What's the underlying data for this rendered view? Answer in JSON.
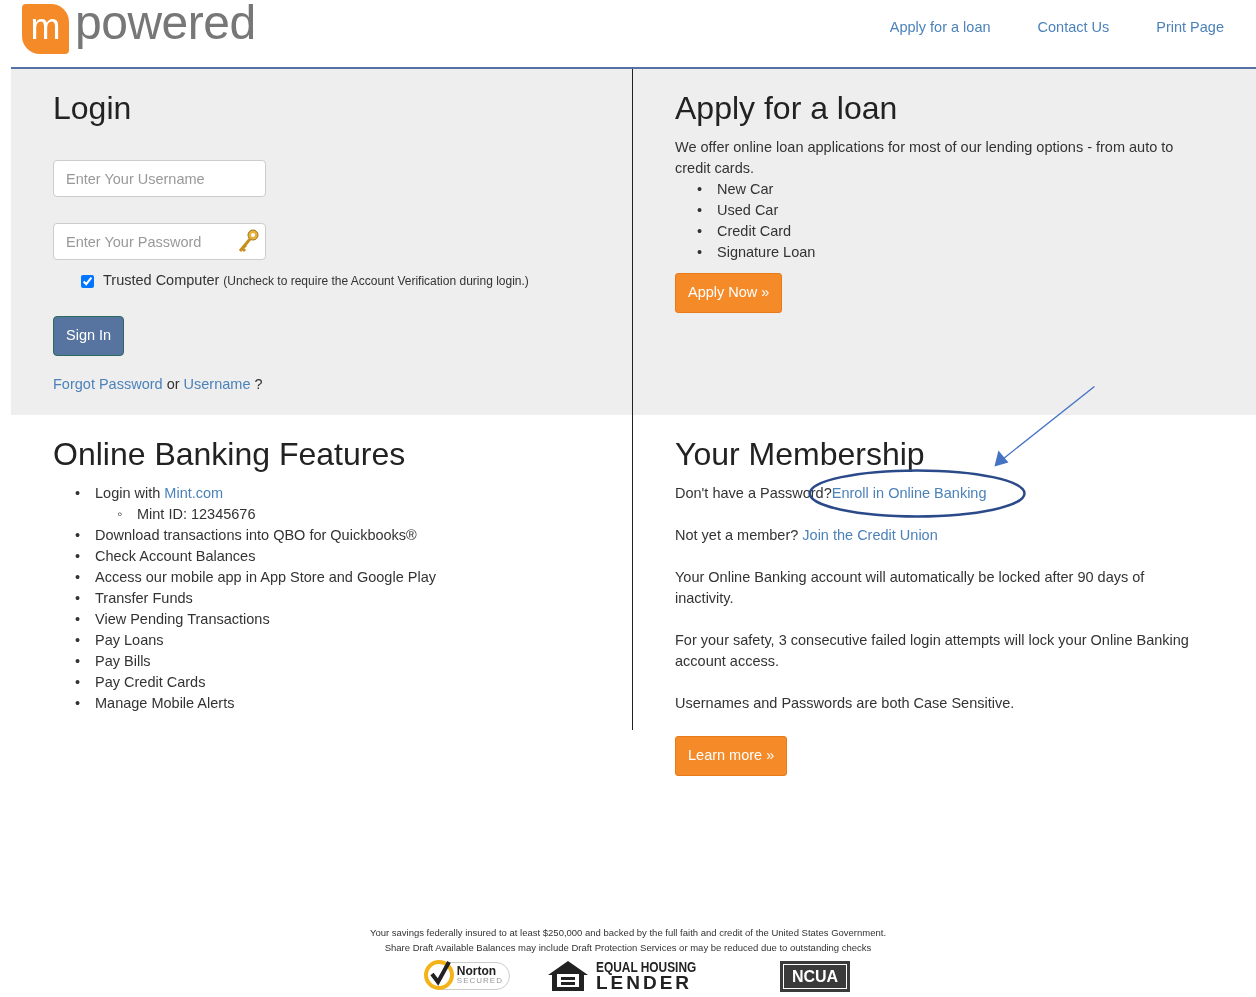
{
  "logo": {
    "mark": "m",
    "text": "powered"
  },
  "nav": [
    {
      "label": "Apply for a loan"
    },
    {
      "label": "Contact Us"
    },
    {
      "label": "Print Page"
    }
  ],
  "login": {
    "title": "Login",
    "username": {
      "placeholder": "Enter Your Username"
    },
    "password": {
      "placeholder": "Enter Your Password"
    },
    "trusted": {
      "checked": true,
      "label": "Trusted Computer",
      "note": "(Uncheck to require the Account Verification during login.)"
    },
    "sign_in": "Sign In",
    "forgot": {
      "link1": "Forgot Password",
      "middle": "or",
      "link2": "Username",
      "end": "?"
    }
  },
  "loan": {
    "title": "Apply for a loan",
    "intro": "We offer online loan applications for most of our lending options - from auto to credit cards.",
    "items": [
      {
        "marker": "•",
        "text": "New Car"
      },
      {
        "marker": "•",
        "text": "Used Car"
      },
      {
        "marker": "•",
        "text": "Credit Card"
      },
      {
        "marker": "•",
        "text": "Signature Loan"
      }
    ],
    "button": "Apply Now »"
  },
  "features": {
    "title": "Online Banking Features",
    "items": [
      {
        "marker": "•",
        "text": "Login with ",
        "link": "Mint.com",
        "children": [
          {
            "marker": "◦",
            "text": "Mint ID: 12345676"
          }
        ]
      },
      {
        "marker": "•",
        "text": "Download transactions into QBO for Quickbooks®"
      },
      {
        "marker": "•",
        "text": "Check Account Balances"
      },
      {
        "marker": "•",
        "text": "Access our mobile app in App Store and Google Play"
      },
      {
        "marker": "•",
        "text": "Transfer Funds"
      },
      {
        "marker": "•",
        "text": "View Pending Transactions"
      },
      {
        "marker": "•",
        "text": "Pay Loans"
      },
      {
        "marker": "•",
        "text": "Pay Bills"
      },
      {
        "marker": "•",
        "text": "Pay Credit Cards"
      },
      {
        "marker": "•",
        "text": "Manage Mobile Alerts"
      }
    ]
  },
  "membership": {
    "title": "Your Membership",
    "paragraphs": [
      {
        "text": "Don't have a Password?",
        "link": "Enroll in Online Banking",
        "highlighted": true
      },
      {
        "text": "Not yet a member? ",
        "link": "Join the Credit Union",
        "highlighted": false
      },
      {
        "text": "Your Online Banking account will automatically be locked after 90 days of inactivity."
      },
      {
        "text": "For your safety, 3 consecutive failed login attempts will lock your Online Banking account access."
      },
      {
        "text": "Usernames and Passwords are both Case Sensitive."
      }
    ],
    "button": "Learn more »"
  },
  "footer": {
    "lines": [
      "Your savings federally insured to at least $250,000 and backed by the full faith and credit of the United States Government.",
      "Share Draft Available Balances may include Draft Protection Services or may be reduced due to outstanding checks"
    ],
    "badges": [
      {
        "kind": "norton",
        "title": "Norton",
        "sub": "SECURED"
      },
      {
        "kind": "housing",
        "title": "EQUAL HOUSING",
        "sub": "LENDER"
      },
      {
        "kind": "ncua",
        "title": "NCUA"
      }
    ]
  }
}
